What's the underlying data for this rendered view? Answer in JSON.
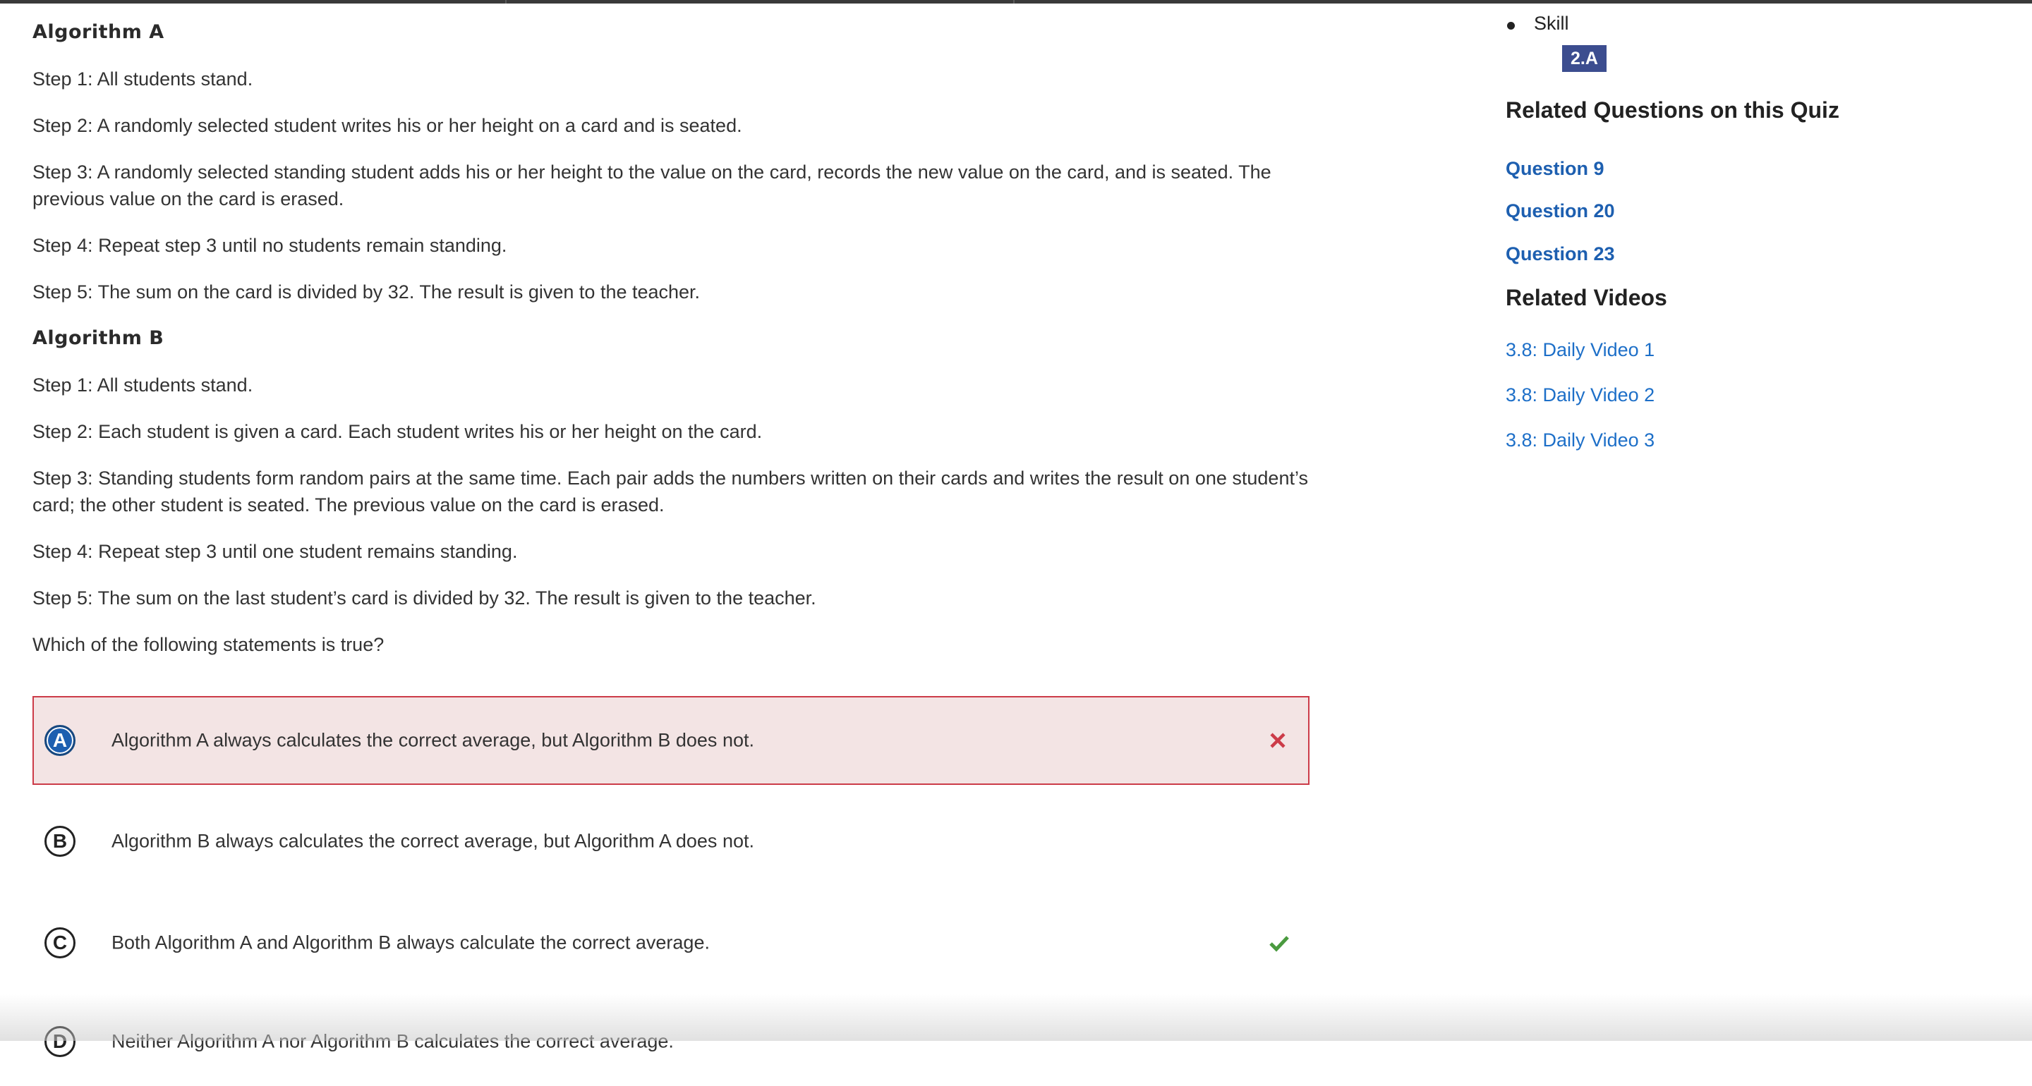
{
  "question": {
    "algorithm_a": {
      "heading": "Algorithm A",
      "steps": [
        "Step 1: All students stand.",
        "Step 2: A randomly selected student writes his or her height on a card and is seated.",
        "Step 3: A randomly selected standing student adds his or her height to the value on the card, records the new value on the card, and is seated. The previous value on the card is erased.",
        "Step 4: Repeat step 3 until no students remain standing.",
        "Step 5: The sum on the card is divided by 32. The result is given to the teacher."
      ]
    },
    "algorithm_b": {
      "heading": "Algorithm B",
      "steps": [
        "Step 1: All students stand.",
        "Step 2: Each student is given a card. Each student writes his or her height on the card.",
        "Step 3: Standing students form random pairs at the same time. Each pair adds the numbers written on their cards and writes the result on one student’s card; the other student is seated. The previous value on the card is erased.",
        "Step 4: Repeat step 3 until one student remains standing.",
        "Step 5: The sum on the last student’s card is divided by 32. The result is given to the teacher."
      ]
    },
    "prompt": "Which of the following statements is true?"
  },
  "answers": [
    {
      "letter": "A",
      "text": "Algorithm A always calculates the correct average, but Algorithm B does not.",
      "state": "selected-incorrect",
      "mark_icon": "x-icon"
    },
    {
      "letter": "B",
      "text": "Algorithm B always calculates the correct average, but Algorithm A does not.",
      "state": "unselected"
    },
    {
      "letter": "C",
      "text": "Both Algorithm A and Algorithm B always calculate the correct average.",
      "state": "correct",
      "mark_icon": "checkmark-icon"
    },
    {
      "letter": "D",
      "text": "Neither Algorithm A nor Algorithm B calculates the correct average.",
      "state": "unselected",
      "partially_visible": true
    }
  ],
  "sidebar": {
    "skill_label": "Skill",
    "skill_code": "2.A",
    "related_questions_heading": "Related Questions on this Quiz",
    "related_questions": [
      "Question 9",
      "Question 20",
      "Question 23"
    ],
    "related_videos_heading": "Related Videos",
    "related_videos": [
      "3.8: Daily Video 1",
      "3.8: Daily Video 2",
      "3.8: Daily Video 3"
    ]
  },
  "colors": {
    "link_blue": "#1d5fb0",
    "badge_navy": "#3c4d8f",
    "incorrect_red": "#cc3b48",
    "incorrect_bg": "#f3e4e4",
    "correct_green": "#4a9a3f"
  }
}
